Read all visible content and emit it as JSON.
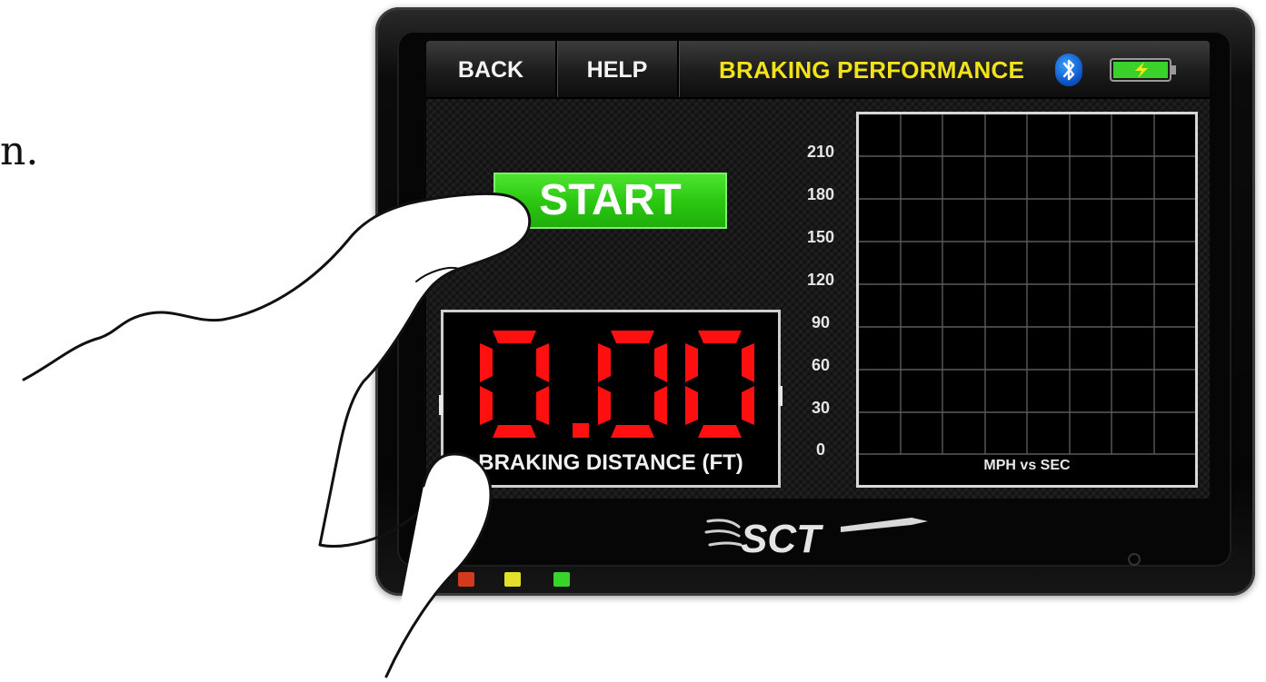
{
  "page_text": {
    "margin_period": "n."
  },
  "topbar": {
    "back_label": "BACK",
    "help_label": "HELP",
    "title": "BRAKING PERFORMANCE",
    "bluetooth_icon": "bluetooth-icon",
    "battery_icon": "battery-charging-icon"
  },
  "start": {
    "label": "START"
  },
  "readout": {
    "value": "0.00",
    "label": "BRAKING DISTANCE (FT)"
  },
  "graph": {
    "caption": "MPH vs SEC",
    "y_ticks": [
      "210",
      "180",
      "150",
      "120",
      "90",
      "60",
      "30",
      "0"
    ]
  },
  "logo": {
    "text": "SCT"
  },
  "colors": {
    "title_yellow": "#f2e21a",
    "start_green": "#2cc912",
    "readout_red": "#ff1010",
    "led_red": "#d13a1d",
    "led_yellow": "#e2e02a",
    "led_green": "#37d42b"
  }
}
